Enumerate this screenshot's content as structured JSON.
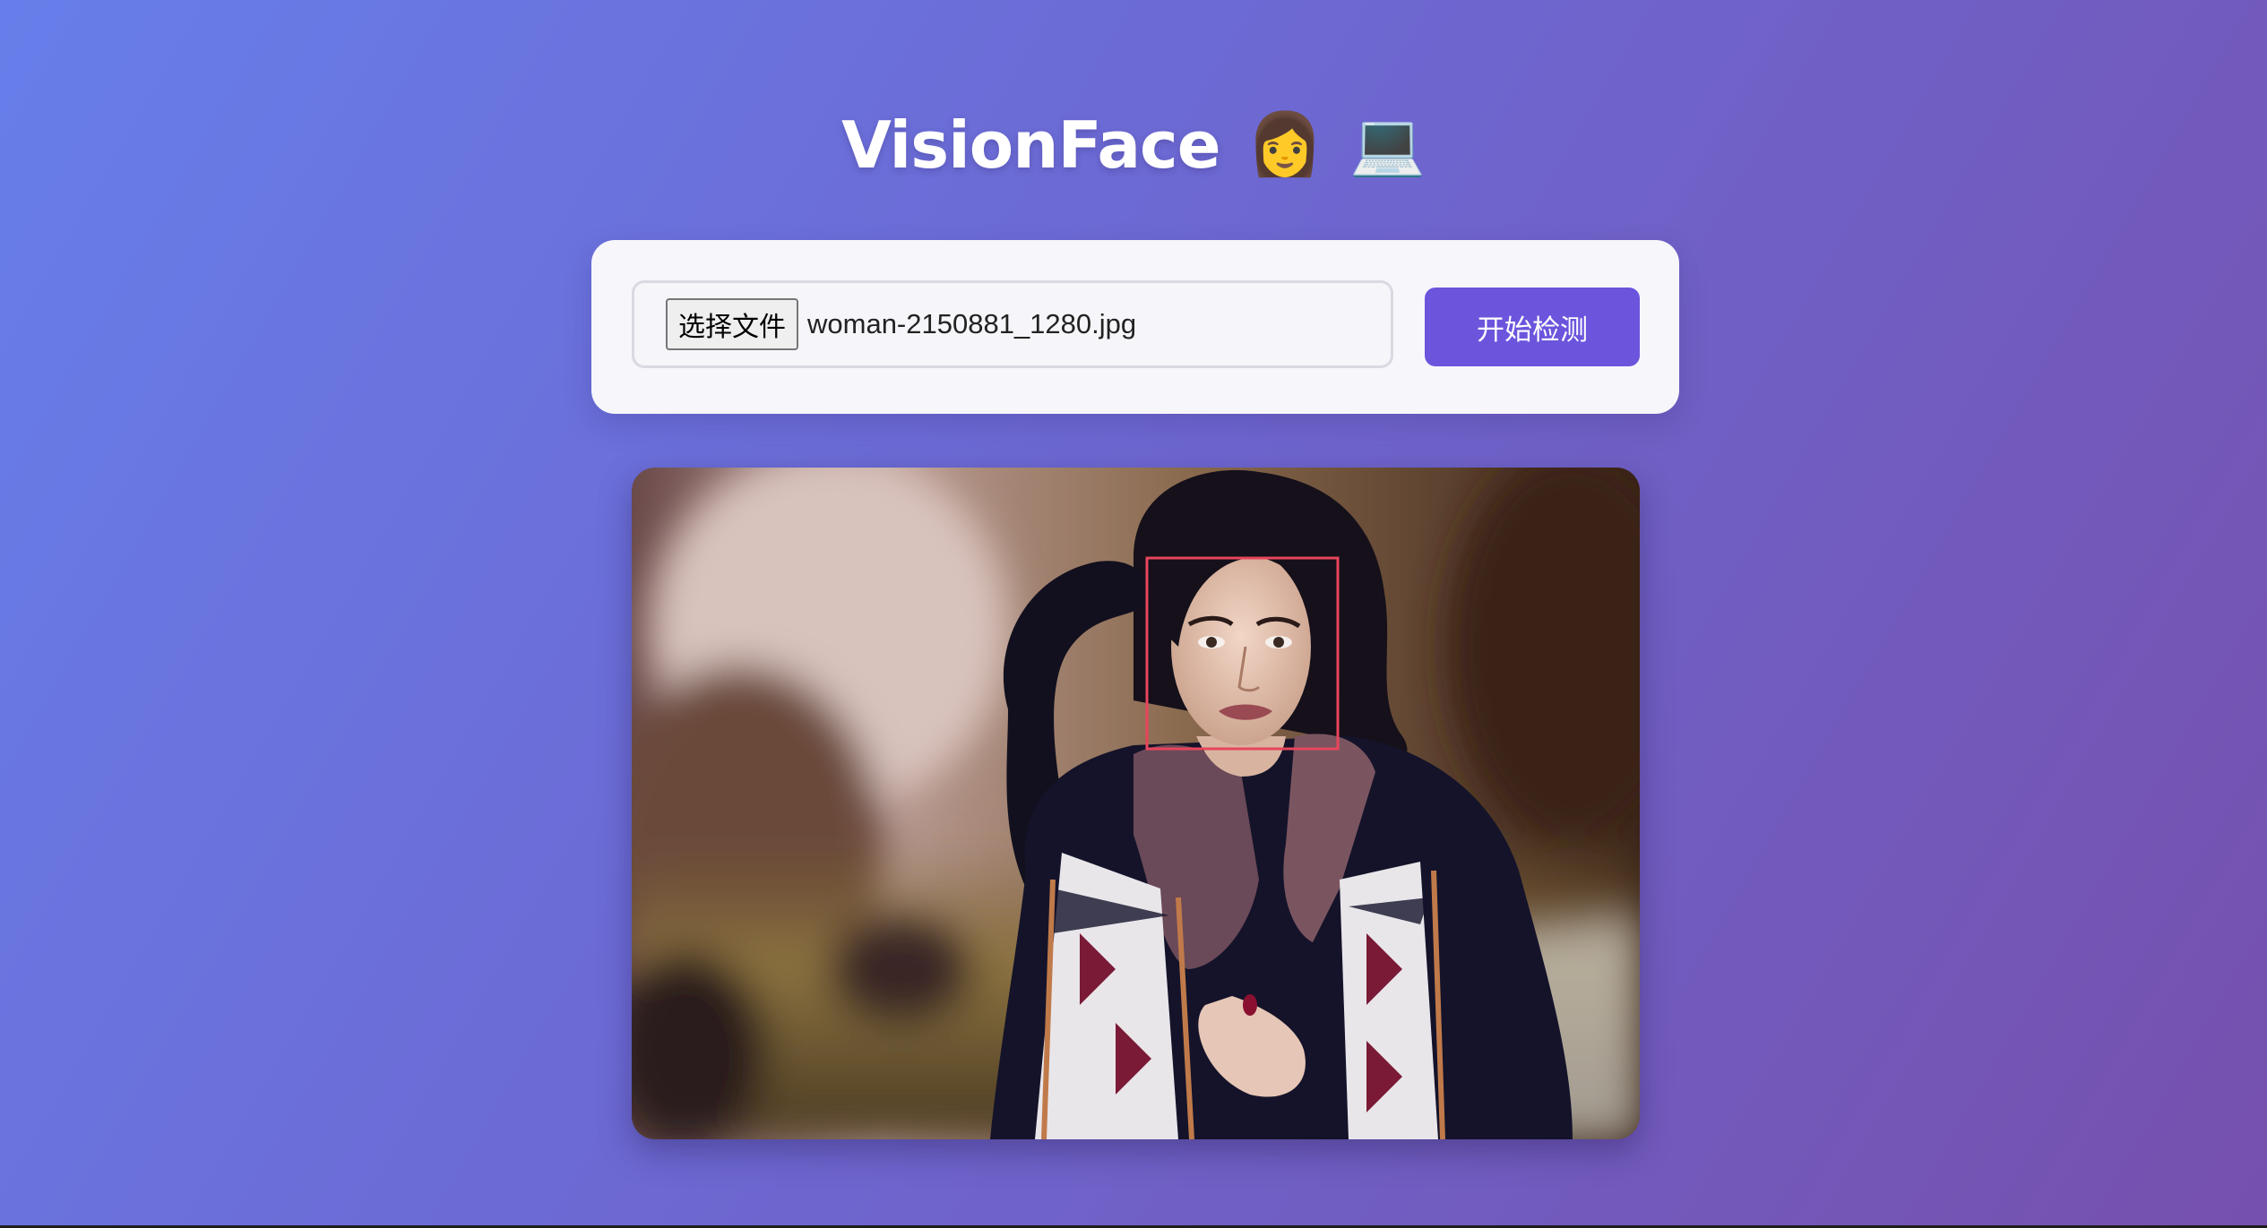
{
  "header": {
    "title": "VisionFace",
    "emojis": [
      "👩",
      "💻"
    ]
  },
  "upload": {
    "choose_file_label": "选择文件",
    "file_name": "woman-2150881_1280.jpg",
    "detect_button_label": "开始检测"
  },
  "result": {
    "image_description_icon": "photo-of-woman",
    "face_box_color": "#e8455b",
    "faces_detected": 1
  },
  "colors": {
    "accent": "#6c55dc",
    "background_start": "#677eea",
    "background_end": "#7650ad"
  }
}
